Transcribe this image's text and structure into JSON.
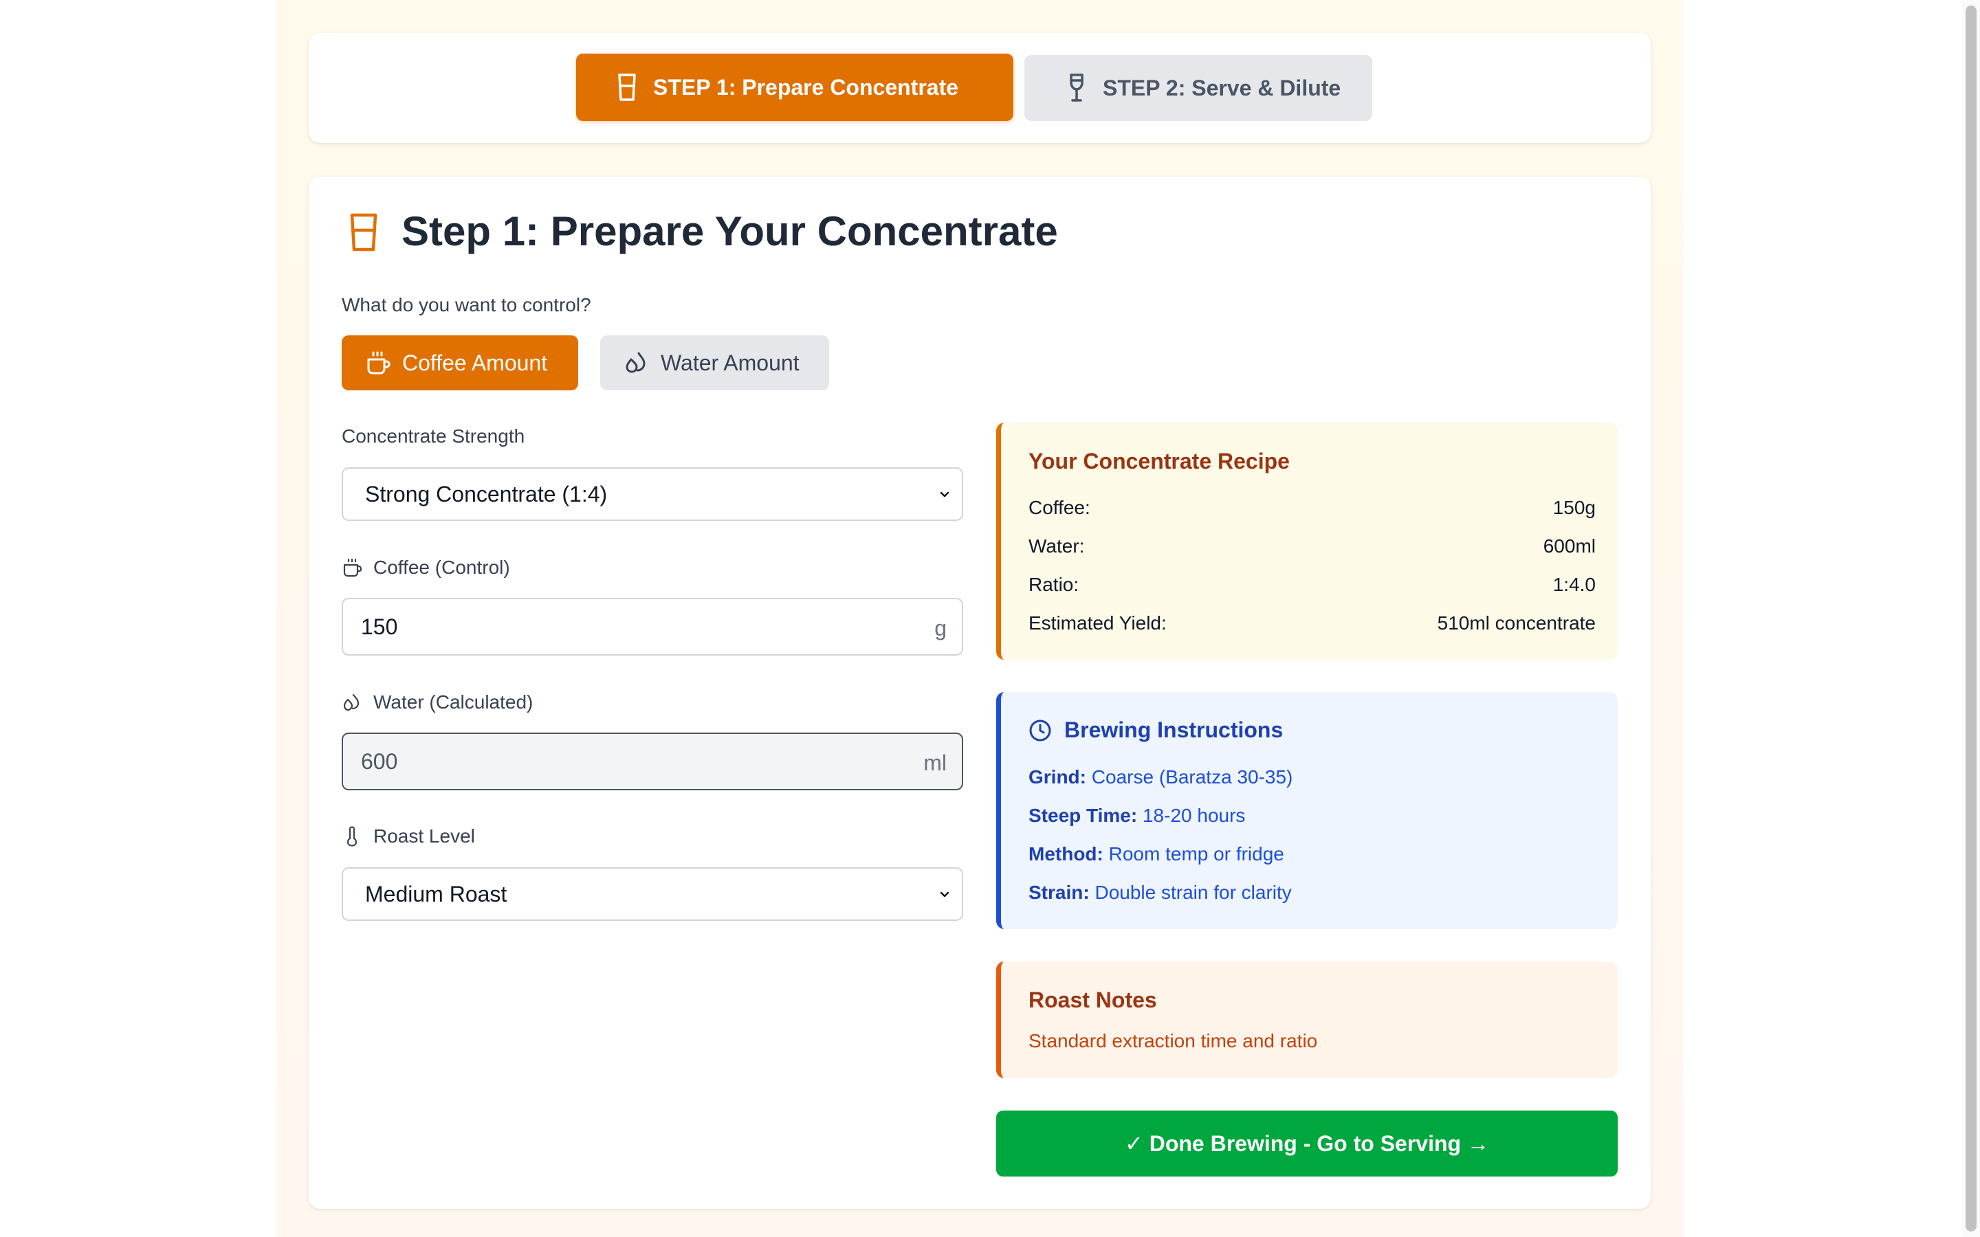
{
  "steps": {
    "step1_label": "STEP 1: Prepare Concentrate",
    "step2_label": "STEP 2: Serve & Dilute",
    "active_step": 1
  },
  "main": {
    "title": "Step 1: Prepare Your Concentrate",
    "control_question": "What do you want to control?",
    "control_options": {
      "coffee_label": "Coffee Amount",
      "water_label": "Water Amount",
      "selected": "Coffee Amount"
    },
    "strength": {
      "label": "Concentrate Strength",
      "selected": "Strong Concentrate (1:4)"
    },
    "coffee_field": {
      "label": "Coffee (Control)",
      "value": "150",
      "unit": "g"
    },
    "water_field": {
      "label": "Water (Calculated)",
      "value": "600",
      "unit": "ml"
    },
    "roast": {
      "label": "Roast Level",
      "selected": "Medium Roast"
    }
  },
  "recipe": {
    "title": "Your Concentrate Recipe",
    "rows": [
      {
        "key": "Coffee:",
        "value": "150g"
      },
      {
        "key": "Water:",
        "value": "600ml"
      },
      {
        "key": "Ratio:",
        "value": "1:4.0"
      },
      {
        "key": "Estimated Yield:",
        "value": "510ml concentrate"
      }
    ]
  },
  "instructions": {
    "title": "Brewing Instructions",
    "lines": [
      {
        "key": "Grind:",
        "value": "Coarse (Baratza 30-35)"
      },
      {
        "key": "Steep Time:",
        "value": "18-20 hours"
      },
      {
        "key": "Method:",
        "value": "Room temp or fridge"
      },
      {
        "key": "Strain:",
        "value": "Double strain for clarity"
      }
    ]
  },
  "notes": {
    "title": "Roast Notes",
    "text": "Standard extraction time and ratio"
  },
  "done_button": {
    "label": "✓ Done Brewing - Go to Serving →"
  },
  "colors": {
    "accent_orange": "#e07000",
    "success_green": "#00a63e",
    "info_blue": "#1d4ed8",
    "inactive_gray": "#e5e7eb"
  },
  "icons": {
    "step1": "cup-glass-icon",
    "step2": "wine-glass-icon",
    "coffee": "coffee-cup-icon",
    "water": "droplets-icon",
    "roast": "thermometer-icon",
    "instructions": "clock-icon",
    "select": "chevron-down-icon"
  }
}
